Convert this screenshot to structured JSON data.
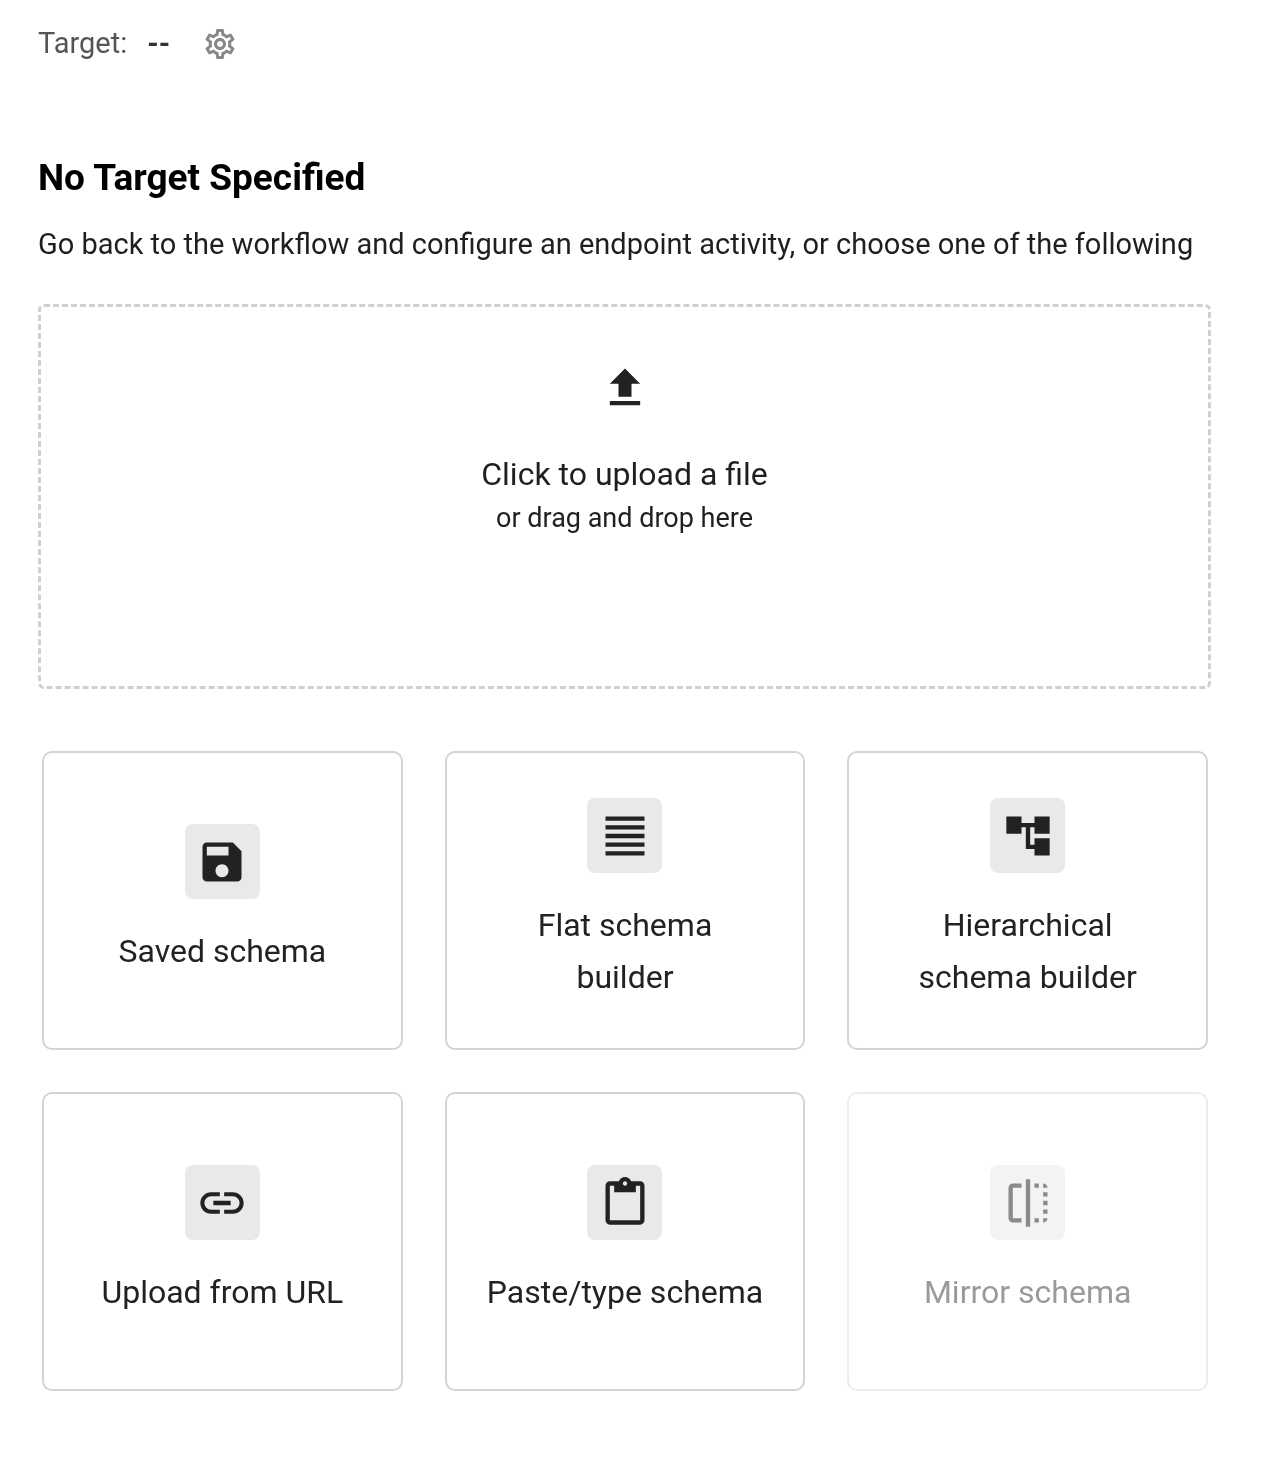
{
  "target": {
    "label": "Target:",
    "value": "--"
  },
  "heading": "No Target Specified",
  "description": "Go back to the workflow and configure an endpoint activity, or choose one of the following",
  "upload": {
    "title": "Click to upload a file",
    "subtitle": "or drag and drop here"
  },
  "options": [
    {
      "kind": "saved",
      "label": "Saved schema",
      "disabled": false
    },
    {
      "kind": "flat",
      "label": "Flat schema builder",
      "disabled": false
    },
    {
      "kind": "hierarchical",
      "label": "Hierarchical schema builder",
      "disabled": false
    },
    {
      "kind": "url",
      "label": "Upload from URL",
      "disabled": false
    },
    {
      "kind": "paste",
      "label": "Paste/type schema",
      "disabled": false
    },
    {
      "kind": "mirror",
      "label": "Mirror schema",
      "disabled": true
    }
  ]
}
